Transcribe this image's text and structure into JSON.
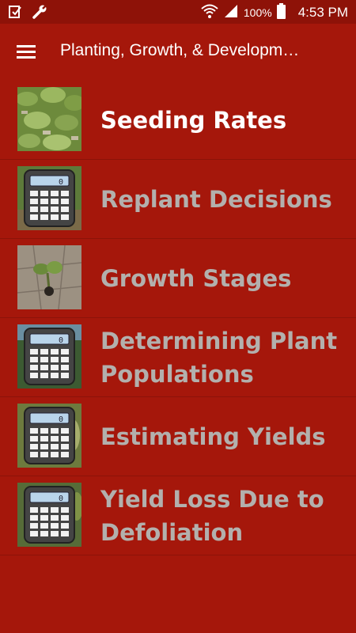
{
  "status_bar": {
    "battery_text": "100%",
    "time": "4:53 PM",
    "icons": [
      "notification-icon",
      "wrench-icon",
      "wifi-icon",
      "signal-icon",
      "battery-icon"
    ]
  },
  "app_bar": {
    "title": "Planting, Growth, & Developm…",
    "menu_icon": "hamburger-menu-icon"
  },
  "colors": {
    "background": "#a5170b",
    "status_bar": "#8e1208",
    "active_text": "#ffffff",
    "inactive_text": "#b3b0ad"
  },
  "items": [
    {
      "label": "Seeding Rates",
      "thumbnail": "soybean-field-photo",
      "active": true
    },
    {
      "label": "Replant Decisions",
      "thumbnail": "calculator-icon",
      "active": false
    },
    {
      "label": "Growth Stages",
      "thumbnail": "seedling-photo",
      "active": false
    },
    {
      "label": "Determining Plant Populations",
      "thumbnail": "calculator-icon",
      "active": false
    },
    {
      "label": "Estimating Yields",
      "thumbnail": "calculator-icon",
      "active": false
    },
    {
      "label": "Yield Loss Due to Defoliation",
      "thumbnail": "calculator-icon",
      "active": false
    }
  ]
}
